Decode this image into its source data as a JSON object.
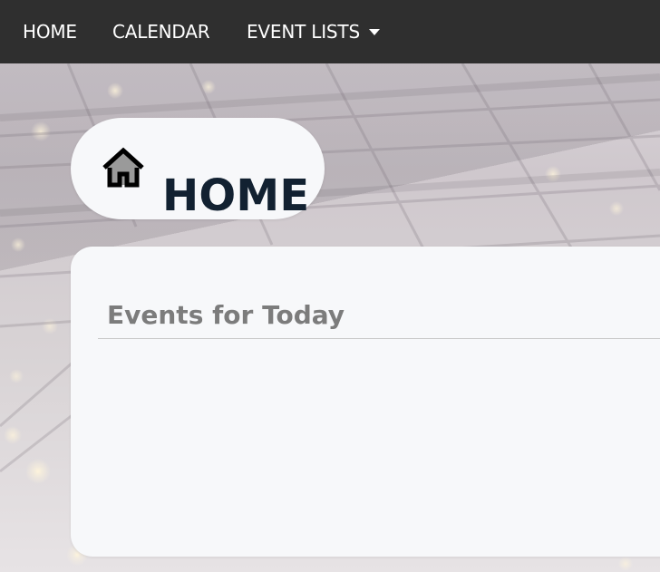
{
  "nav": {
    "items": [
      {
        "label": "HOME"
      },
      {
        "label": "CALENDAR"
      },
      {
        "label": "EVENT LISTS"
      }
    ]
  },
  "hero": {
    "title": "HOME",
    "icon": "home-icon"
  },
  "events": {
    "heading": "Events for Today",
    "items": []
  },
  "colors": {
    "navbar": "#2f2f2f",
    "nav_text": "#ffffff",
    "card_background": "#f7f8fa",
    "title_text": "#122131",
    "heading_text": "#7c7c7c",
    "divider": "#c8c8c8"
  }
}
